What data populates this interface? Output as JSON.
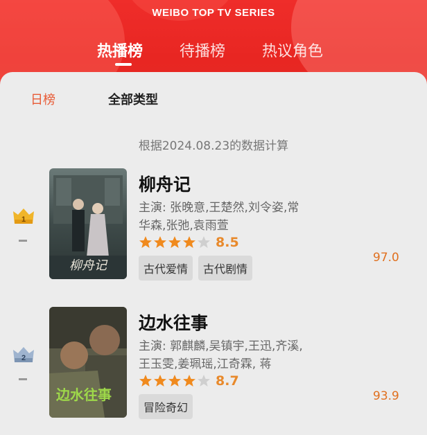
{
  "header": {
    "brand": "WEIBO TOP TV SERIES",
    "tabs": [
      {
        "label": "热播榜",
        "active": true
      },
      {
        "label": "待播榜",
        "active": false
      },
      {
        "label": "热议角色",
        "active": false
      }
    ],
    "accent_color": "#e82622"
  },
  "filters": {
    "period": "日榜",
    "category": "全部类型",
    "period_color": "#e85a35"
  },
  "basis_text": "根据2024.08.23的数据计算",
  "items": [
    {
      "rank": "1",
      "title": "柳舟记",
      "cast": "主演: 张晚意,王楚然,刘令姿,常华森,张弛,袁雨萱",
      "stars_filled": 4,
      "rating": "8.5",
      "tags": [
        "古代爱情",
        "古代剧情"
      ],
      "score": "97.0",
      "poster_text": "柳舟记",
      "badge_color": "#f0b52a"
    },
    {
      "rank": "2",
      "title": "边水往事",
      "cast": "主演: 郭麒麟,吴镇宇,王迅,齐溪,王玉雯,姜珮瑶,江奇霖, 蒋",
      "stars_filled": 4,
      "rating": "8.7",
      "tags": [
        "冒险奇幻"
      ],
      "score": "93.9",
      "poster_text": "边水往事",
      "badge_color": "#8aa2c0"
    }
  ],
  "icons": {
    "star": "star-icon",
    "crown": "crown-icon"
  },
  "colors": {
    "star_filled": "#f08a1e",
    "star_empty": "#cfcfcf",
    "rating": "#e8892b",
    "score": "#e0701f"
  }
}
